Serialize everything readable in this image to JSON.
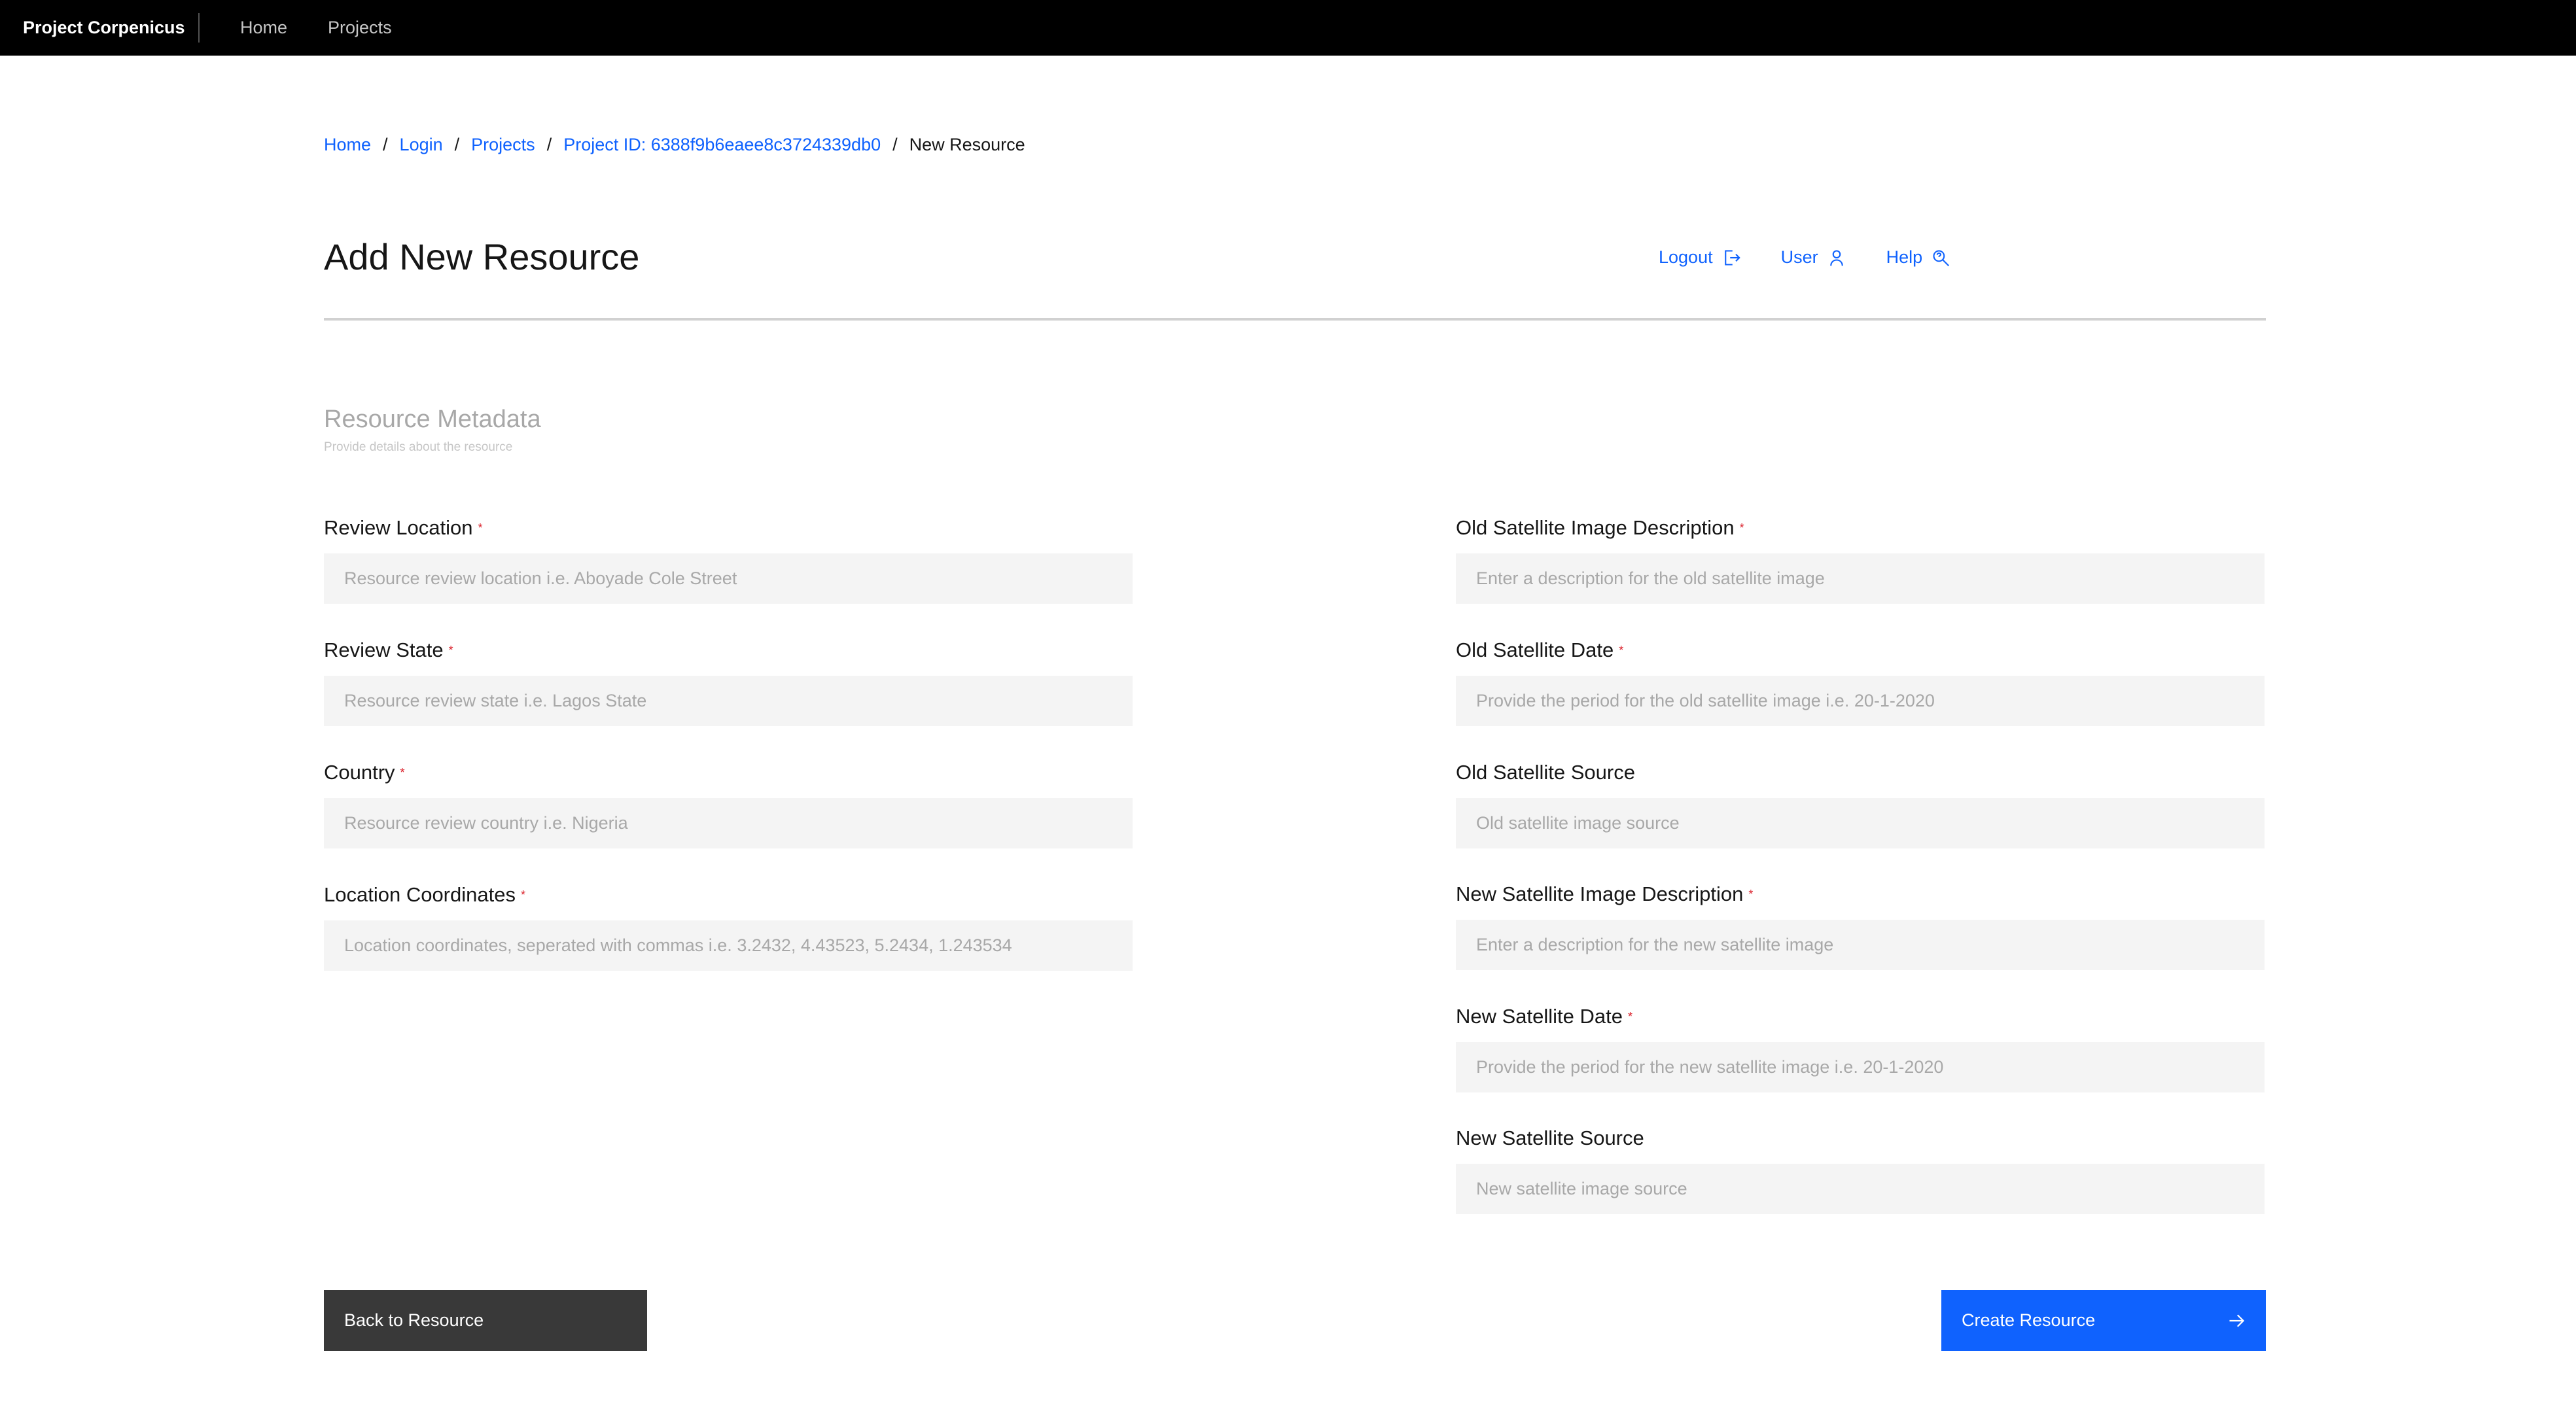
{
  "header": {
    "brand": "Project Corpenicus",
    "nav": [
      {
        "label": "Home"
      },
      {
        "label": "Projects"
      }
    ]
  },
  "breadcrumb": {
    "items": [
      "Home",
      "Login",
      "Projects",
      "Project ID: 6388f9b6eaee8c3724339db0"
    ],
    "separator": "/",
    "current": "New Resource"
  },
  "page": {
    "title": "Add New Resource",
    "links": {
      "logout": "Logout",
      "user": "User",
      "help": "Help"
    }
  },
  "section": {
    "title": "Resource Metadata",
    "subtitle": "Provide details about the resource"
  },
  "form": {
    "required_mark": "*",
    "left": [
      {
        "label": "Review Location",
        "placeholder": "Resource review location i.e. Aboyade Cole Street",
        "value": ""
      },
      {
        "label": "Review State",
        "placeholder": "Resource review state i.e. Lagos State",
        "value": ""
      },
      {
        "label": "Country",
        "placeholder": "Resource review country i.e. Nigeria",
        "value": ""
      },
      {
        "label": "Location Coordinates",
        "placeholder": "Location coordinates, seperated with commas i.e. 3.2432, 4.43523, 5.2434, 1.243534",
        "value": ""
      }
    ],
    "right": [
      {
        "label": "Old Satellite Image Description",
        "placeholder": "Enter a description for the old satellite image",
        "value": ""
      },
      {
        "label": "Old Satellite Date",
        "placeholder": "Provide the period for the old satellite image i.e. 20-1-2020",
        "value": ""
      },
      {
        "label": "Old Satellite Source",
        "placeholder": "Old satellite image source",
        "value": ""
      },
      {
        "label": "New Satellite Image Description",
        "placeholder": "Enter a description for the new satellite image",
        "value": ""
      },
      {
        "label": "New Satellite Date",
        "placeholder": "Provide the period for the new satellite image i.e. 20-1-2020",
        "value": ""
      },
      {
        "label": "New Satellite Source",
        "placeholder": "New satellite image source",
        "value": ""
      }
    ]
  },
  "actions": {
    "back": "Back to Resource",
    "create": "Create Resource"
  },
  "colors": {
    "accent": "#0f62fe",
    "topbar": "#000000",
    "secondary_button": "#393939",
    "required": "#da1e28"
  }
}
